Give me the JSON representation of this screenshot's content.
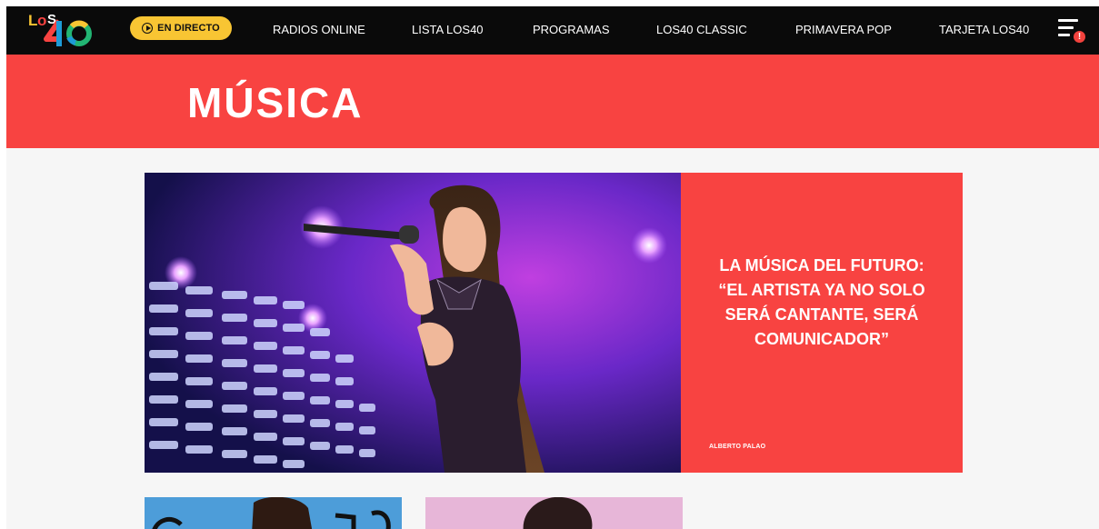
{
  "nav": {
    "live_label": "EN DIRECTO",
    "items": [
      {
        "label": "RADIOS ONLINE"
      },
      {
        "label": "LISTA LOS40"
      },
      {
        "label": "PROGRAMAS"
      },
      {
        "label": "LOS40 CLASSIC"
      },
      {
        "label": "PRIMAVERA POP"
      },
      {
        "label": "TARJETA LOS40"
      }
    ],
    "menu_badge": "!"
  },
  "section": {
    "title": "MÚSICA"
  },
  "hero": {
    "headline": "LA MÚSICA DEL FUTURO: “EL ARTISTA YA NO SOLO SERÁ CANTANTE, SERÁ COMUNICADOR”",
    "author": "ALBERTO PALAO"
  },
  "colors": {
    "brand_red": "#f84341",
    "nav_bg": "#0a0a0a",
    "live_yellow": "#f8c533"
  },
  "icons": [
    "los40-logo",
    "play-circle-icon",
    "hamburger-menu-icon",
    "alert-badge-icon"
  ]
}
